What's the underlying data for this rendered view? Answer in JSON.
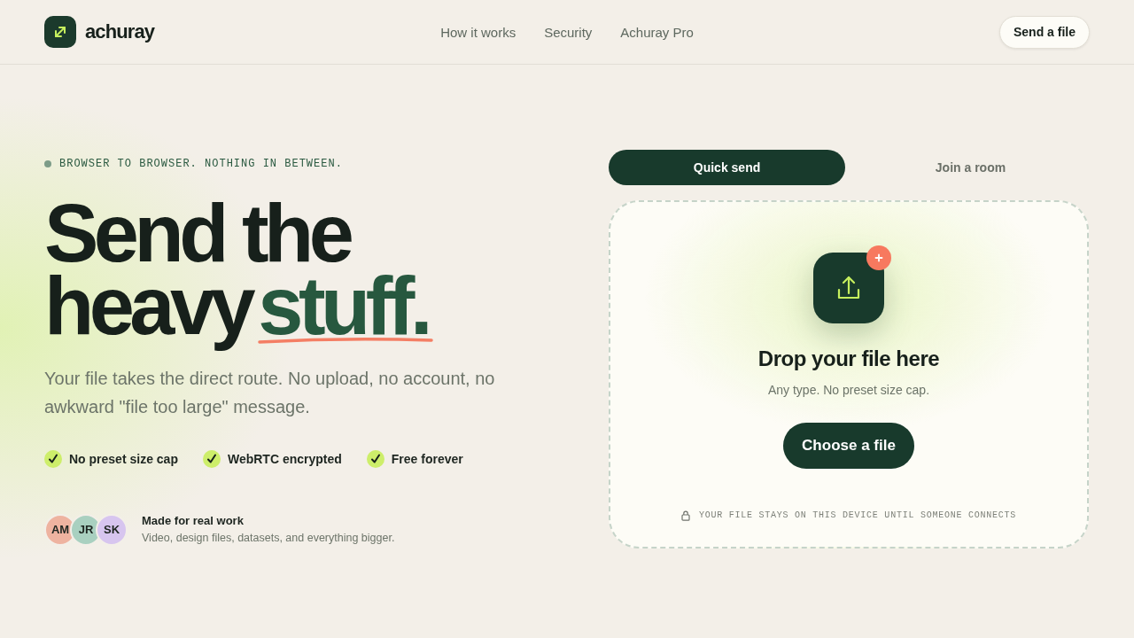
{
  "header": {
    "brand": "achuray",
    "nav": [
      {
        "label": "How it works"
      },
      {
        "label": "Security"
      },
      {
        "label": "Achuray Pro"
      }
    ],
    "cta": "Send a file"
  },
  "hero": {
    "eyebrow": "BROWSER TO BROWSER. NOTHING IN BETWEEN.",
    "headline": {
      "line_1": "Send the",
      "line_2": "heavy",
      "accent": "stuff."
    },
    "lead": "Your file takes the direct route. No upload, no account, no awkward \"file too large\" message.",
    "features": [
      {
        "label": "No preset size cap"
      },
      {
        "label": "WebRTC encrypted"
      },
      {
        "label": "Free forever"
      }
    ],
    "proof": {
      "avatars": [
        {
          "initials": "AM",
          "color": "#eeb3a0"
        },
        {
          "initials": "JR",
          "color": "#a9d0c0"
        },
        {
          "initials": "SK",
          "color": "#d7c5ef"
        }
      ],
      "title": "Made for real work",
      "text": "Video, design files, datasets, and everything bigger."
    }
  },
  "sender": {
    "tabs": [
      {
        "label": "Quick send",
        "selected": true
      },
      {
        "label": "Join a room",
        "selected": false
      }
    ],
    "dropzone": {
      "title": "Drop your file here",
      "hint": "Any type. No preset size cap.",
      "button": "Choose a file",
      "note": "YOUR FILE STAYS ON THIS DEVICE UNTIL SOMEONE CONNECTS"
    }
  }
}
